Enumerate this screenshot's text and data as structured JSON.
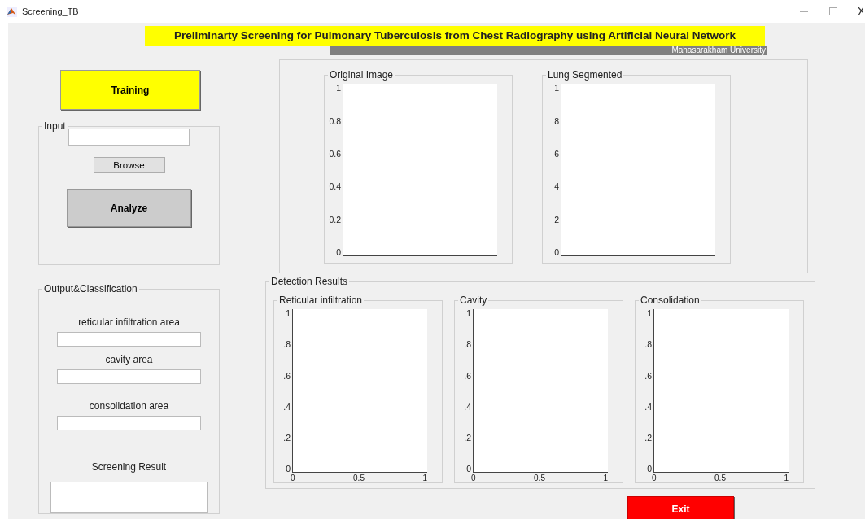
{
  "window": {
    "title": "Screening_TB"
  },
  "banner": {
    "title": "Preliminarty Screening for Pulmonary Tuberculosis from Chest Radiography using Artificial Neural Network",
    "subtitle": "Mahasarakham University"
  },
  "training_button": "Training",
  "input_panel": {
    "title": "Input",
    "browse_button": "Browse",
    "analyze_button": "Analyze"
  },
  "output_panel": {
    "title": "Output&Classification",
    "fields": [
      {
        "label": "reticular infiltration area"
      },
      {
        "label": "cavity area"
      },
      {
        "label": "consolidation area"
      }
    ],
    "result_label": "Screening Result"
  },
  "image_panel": {
    "axes": [
      {
        "title": "Original Image",
        "yticks": [
          "1",
          "0.8",
          "0.6",
          "0.4",
          "0.2",
          "0"
        ]
      },
      {
        "title": "Lung Segmented",
        "yticks": [
          "1",
          "8",
          "6",
          "4",
          "2",
          "0"
        ]
      }
    ]
  },
  "detection_panel": {
    "title": "Detection Results",
    "axes": [
      {
        "title": "Reticular infiltration",
        "yticks": [
          "1",
          ".8",
          ".6",
          ".4",
          ".2",
          "0"
        ],
        "xticks": [
          "0",
          "0.5",
          "1"
        ]
      },
      {
        "title": "Cavity",
        "yticks": [
          "1",
          ".8",
          ".6",
          ".4",
          ".2",
          "0"
        ],
        "xticks": [
          "0",
          "0.5",
          "1"
        ]
      },
      {
        "title": "Consolidation",
        "yticks": [
          "1",
          ".8",
          ".6",
          ".4",
          ".2",
          "0"
        ],
        "xticks": [
          "0",
          "0.5",
          "1"
        ]
      }
    ]
  },
  "exit_button": "Exit"
}
